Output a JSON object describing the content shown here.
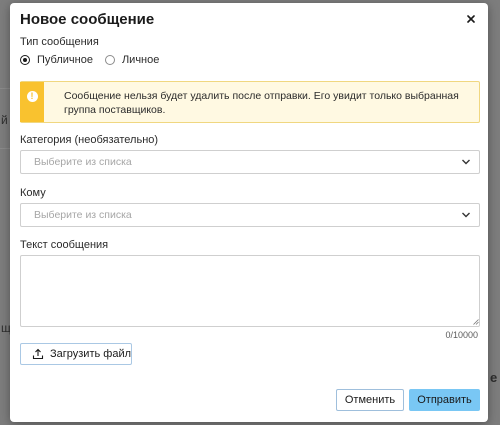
{
  "colors": {
    "overlay": "#7d7d7d",
    "modal_bg": "#ffffff",
    "alert_bg": "#fff9e2",
    "alert_accent": "#f9c22f",
    "primary_button": "#79c7f4",
    "outline_button_border": "#9fbfdc"
  },
  "modal": {
    "title": "Новое сообщение",
    "close_icon": "close-icon"
  },
  "message_type": {
    "label": "Тип сообщения",
    "options": [
      {
        "label": "Публичное",
        "checked": true
      },
      {
        "label": "Личное",
        "checked": false
      }
    ]
  },
  "alert": {
    "icon": "exclamation-icon",
    "text": "Сообщение нельзя будет удалить после отправки. Его увидит только выбранная группа поставщиков."
  },
  "category": {
    "label": "Категория (необязательно)",
    "placeholder": "Выберите из списка",
    "icon": "chevron-down-icon"
  },
  "recipient": {
    "label": "Кому",
    "placeholder": "Выберите из списка",
    "icon": "chevron-down-icon"
  },
  "message_text": {
    "label": "Текст сообщения",
    "value": "",
    "counter": "0/10000"
  },
  "upload": {
    "label": "Загрузить файл",
    "icon": "upload-icon"
  },
  "footer": {
    "cancel_label": "Отменить",
    "send_label": "Отправить"
  },
  "background": {
    "fragments": [
      "й",
      "щ",
      "е"
    ]
  }
}
